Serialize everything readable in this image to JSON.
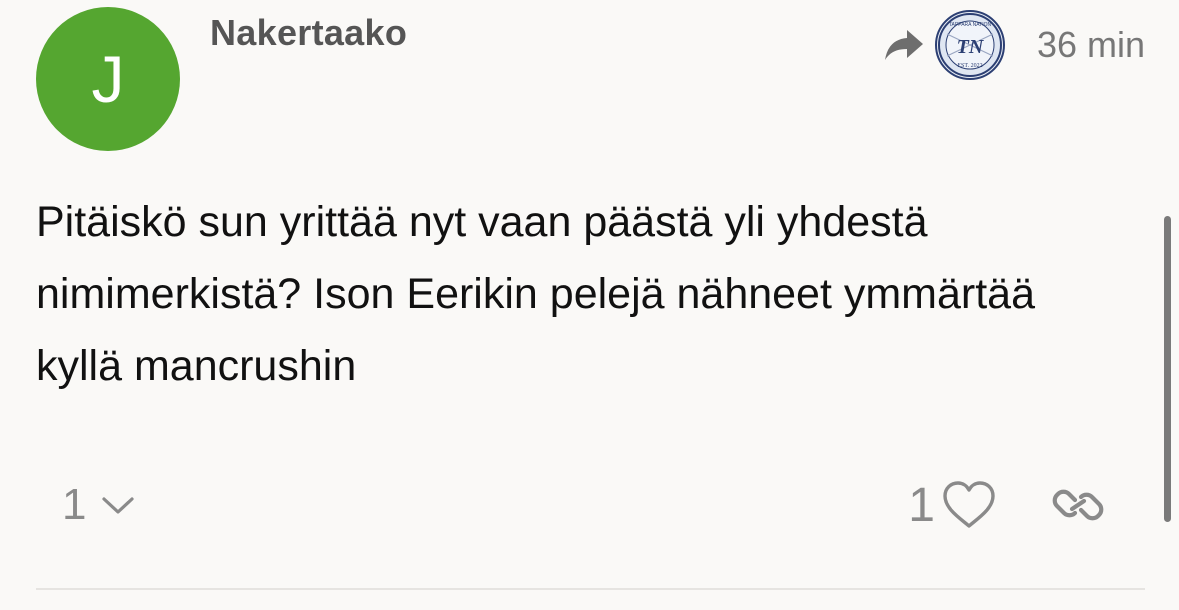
{
  "post": {
    "author": {
      "username": "Nakertaako",
      "avatar_letter": "J",
      "avatar_color": "#55a630"
    },
    "reply_to": {
      "icon": "reply-arrow-icon",
      "avatar_badge_text": "TN",
      "avatar_badge_top": "TAPPARA NATION",
      "avatar_badge_bottom": "EST. 2022"
    },
    "time_ago": "36 min",
    "body": "Pitäiskö sun yrittää nyt vaan päästä yli yhdestä nimimerkistä? Ison Eerikin pelejä nähneet ymmärtää kyllä mancrushin",
    "replies": {
      "count": "1",
      "icon": "chevron-down-icon"
    },
    "likes": {
      "count": "1",
      "icon": "heart-icon"
    },
    "share": {
      "icon": "link-icon"
    }
  },
  "colors": {
    "background": "#faf9f7",
    "text": "#111111",
    "muted": "#8a8a8a"
  }
}
